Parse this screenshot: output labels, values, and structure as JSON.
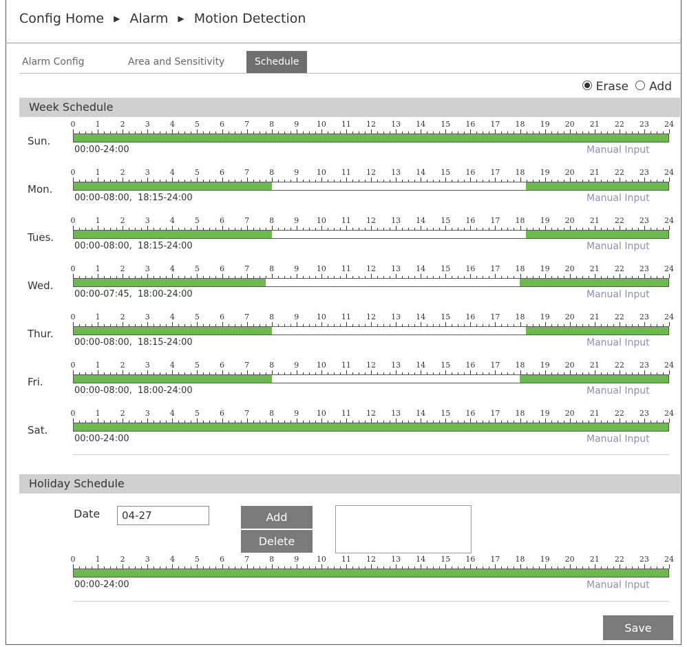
{
  "breadcrumb": [
    "Config Home",
    "Alarm",
    "Motion Detection"
  ],
  "breadcrumb_separator": "▶",
  "tabs": [
    {
      "label": "Alarm Config",
      "active": false
    },
    {
      "label": "Area and Sensitivity",
      "active": false
    },
    {
      "label": "Schedule",
      "active": true
    }
  ],
  "mode": {
    "erase_label": "Erase",
    "add_label": "Add",
    "selected": "Erase"
  },
  "week_schedule": {
    "title": "Week Schedule",
    "hour_labels": [
      "0",
      "1",
      "2",
      "3",
      "4",
      "5",
      "6",
      "7",
      "8",
      "9",
      "10",
      "11",
      "12",
      "13",
      "14",
      "15",
      "16",
      "17",
      "18",
      "19",
      "20",
      "21",
      "22",
      "23",
      "24"
    ],
    "days": [
      {
        "label": "Sun.",
        "ranges_text": "00:00-24:00",
        "segments": [
          [
            0,
            24
          ]
        ]
      },
      {
        "label": "Mon.",
        "ranges_text": "00:00-08:00,  18:15-24:00",
        "segments": [
          [
            0,
            8
          ],
          [
            18.25,
            24
          ]
        ]
      },
      {
        "label": "Tues.",
        "ranges_text": "00:00-08:00,  18:15-24:00",
        "segments": [
          [
            0,
            8
          ],
          [
            18.25,
            24
          ]
        ]
      },
      {
        "label": "Wed.",
        "ranges_text": "00:00-07:45,  18:00-24:00",
        "segments": [
          [
            0,
            7.75
          ],
          [
            18,
            24
          ]
        ]
      },
      {
        "label": "Thur.",
        "ranges_text": "00:00-08:00,  18:15-24:00",
        "segments": [
          [
            0,
            8
          ],
          [
            18.25,
            24
          ]
        ]
      },
      {
        "label": "Fri.",
        "ranges_text": "00:00-08:00,  18:00-24:00",
        "segments": [
          [
            0,
            8
          ],
          [
            18,
            24
          ]
        ]
      },
      {
        "label": "Sat.",
        "ranges_text": "00:00-24:00",
        "segments": [
          [
            0,
            24
          ]
        ]
      }
    ],
    "manual_input_label": "Manual Input"
  },
  "holiday_schedule": {
    "title": "Holiday Schedule",
    "date_label": "Date",
    "date_value": "04-27",
    "add_label": "Add",
    "delete_label": "Delete",
    "ranges_text": "00:00-24:00",
    "segments": [
      [
        0,
        24
      ]
    ],
    "manual_input_label": "Manual Input"
  },
  "save_label": "Save",
  "colors": {
    "active_segment": "#6abb4c",
    "tab_active_bg": "#6e6e6e",
    "button_bg": "#7a7a7a",
    "manual_input_text": "#8e8eb5"
  }
}
